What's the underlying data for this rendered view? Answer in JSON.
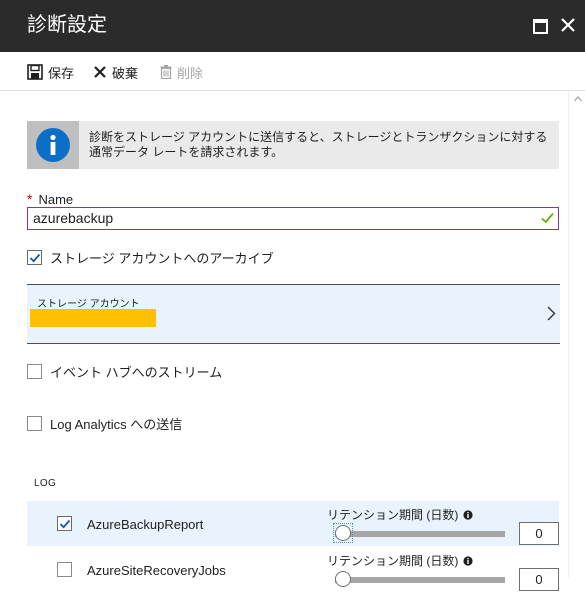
{
  "window": {
    "title": "診断設定"
  },
  "toolbar": {
    "save_label": "保存",
    "discard_label": "破棄",
    "delete_label": "削除"
  },
  "info": {
    "text": "診断をストレージ アカウントに送信すると、ストレージとトランザクションに対する通常データ レートを請求されます。"
  },
  "name_field": {
    "label": "Name",
    "required_mark": "*",
    "value": "azurebackup"
  },
  "archive_storage": {
    "label": "ストレージ アカウントへのアーカイブ",
    "checked": true
  },
  "storage_account": {
    "label": "ストレージ アカウント"
  },
  "event_hub": {
    "label": "イベント ハブへのストリーム",
    "checked": false
  },
  "log_analytics": {
    "label": "Log Analytics への送信",
    "checked": false
  },
  "log_section": {
    "header": "LOG",
    "rows": [
      {
        "name": "AzureBackupReport",
        "checked": true,
        "retention_label": "リテンション期間 (日数)",
        "retention_value": "0"
      },
      {
        "name": "AzureSiteRecoveryJobs",
        "checked": false,
        "retention_label": "リテンション期間 (日数)",
        "retention_value": "0"
      }
    ]
  },
  "colors": {
    "titlebar": "#2b2b2b",
    "accent": "#0078d4",
    "input_border": "#7a3b9b",
    "valid_check": "#5db300",
    "redaction": "#ffc000",
    "selected_row": "#e8f3fd"
  },
  "icons": {
    "save": "save-icon",
    "discard": "close-icon",
    "delete": "trash-icon",
    "info": "info-icon",
    "chevron": "chevron-right-icon"
  }
}
